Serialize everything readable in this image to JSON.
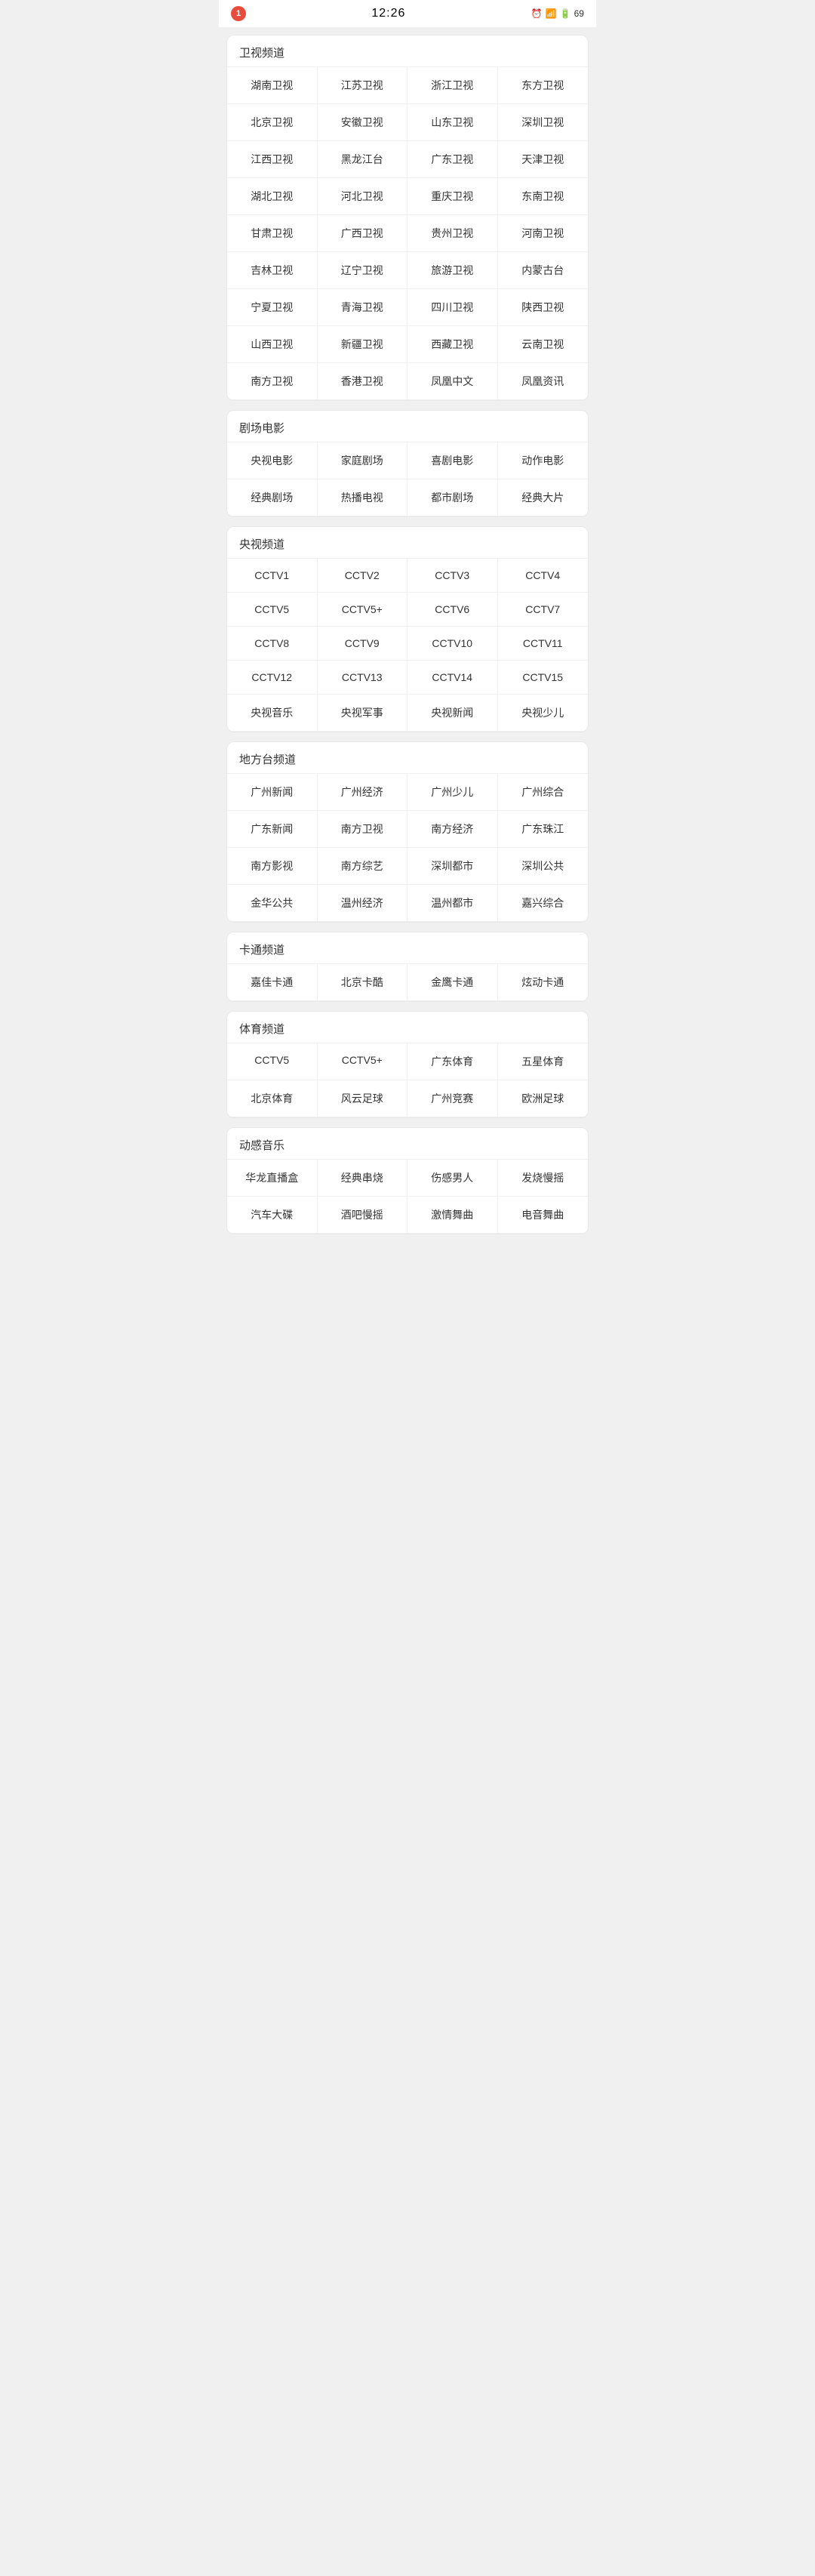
{
  "statusBar": {
    "notification": "1",
    "time": "12:26",
    "battery": "69"
  },
  "sections": [
    {
      "id": "satellite",
      "header": "卫视频道",
      "channels": [
        "湖南卫视",
        "江苏卫视",
        "浙江卫视",
        "东方卫视",
        "北京卫视",
        "安徽卫视",
        "山东卫视",
        "深圳卫视",
        "江西卫视",
        "黑龙江台",
        "广东卫视",
        "天津卫视",
        "湖北卫视",
        "河北卫视",
        "重庆卫视",
        "东南卫视",
        "甘肃卫视",
        "广西卫视",
        "贵州卫视",
        "河南卫视",
        "吉林卫视",
        "辽宁卫视",
        "旅游卫视",
        "内蒙古台",
        "宁夏卫视",
        "青海卫视",
        "四川卫视",
        "陕西卫视",
        "山西卫视",
        "新疆卫视",
        "西藏卫视",
        "云南卫视",
        "南方卫视",
        "香港卫视",
        "凤凰中文",
        "凤凰资讯"
      ]
    },
    {
      "id": "drama-movies",
      "header": "剧场电影",
      "channels": [
        "央视电影",
        "家庭剧场",
        "喜剧电影",
        "动作电影",
        "经典剧场",
        "热播电视",
        "都市剧场",
        "经典大片"
      ]
    },
    {
      "id": "cctv",
      "header": "央视频道",
      "channels": [
        "CCTV1",
        "CCTV2",
        "CCTV3",
        "CCTV4",
        "CCTV5",
        "CCTV5+",
        "CCTV6",
        "CCTV7",
        "CCTV8",
        "CCTV9",
        "CCTV10",
        "CCTV11",
        "CCTV12",
        "CCTV13",
        "CCTV14",
        "CCTV15",
        "央视音乐",
        "央视军事",
        "央视新闻",
        "央视少儿"
      ]
    },
    {
      "id": "local",
      "header": "地方台频道",
      "channels": [
        "广州新闻",
        "广州经济",
        "广州少儿",
        "广州综合",
        "广东新闻",
        "南方卫视",
        "南方经济",
        "广东珠江",
        "南方影视",
        "南方综艺",
        "深圳都市",
        "深圳公共",
        "金华公共",
        "温州经济",
        "温州都市",
        "嘉兴综合"
      ]
    },
    {
      "id": "cartoon",
      "header": "卡通频道",
      "channels": [
        "嘉佳卡通",
        "北京卡酷",
        "金鹰卡通",
        "炫动卡通"
      ]
    },
    {
      "id": "sports",
      "header": "体育频道",
      "channels": [
        "CCTV5",
        "CCTV5+",
        "广东体育",
        "五星体育",
        "北京体育",
        "风云足球",
        "广州竞赛",
        "欧洲足球"
      ]
    },
    {
      "id": "music",
      "header": "动感音乐",
      "channels": [
        "华龙直播盒",
        "经典串烧",
        "伤感男人",
        "发烧慢摇",
        "汽车大碟",
        "酒吧慢摇",
        "激情舞曲",
        "电音舞曲"
      ]
    }
  ]
}
